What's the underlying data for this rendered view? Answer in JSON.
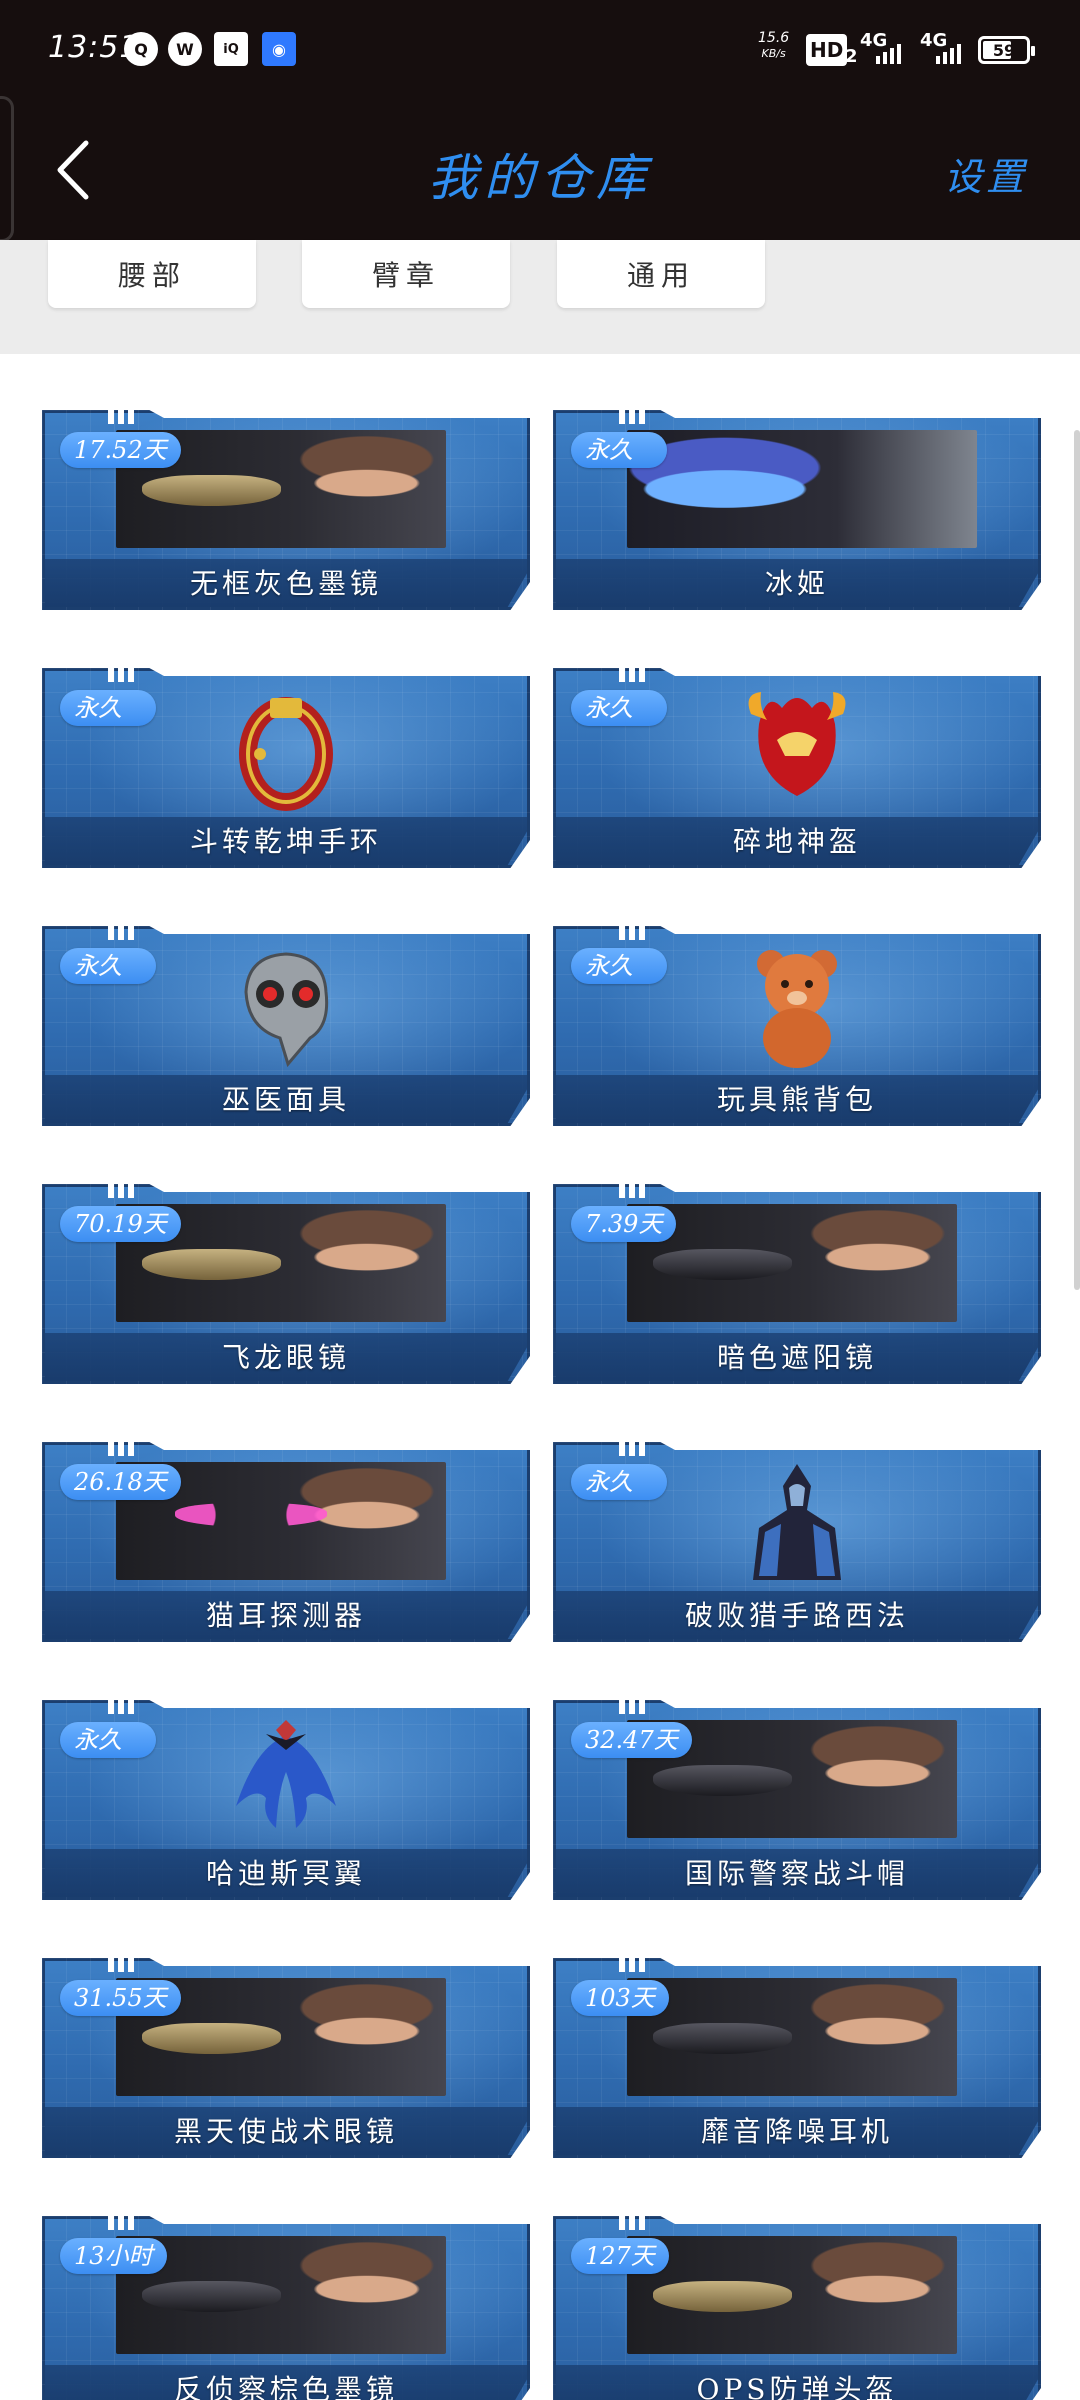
{
  "status_bar": {
    "time": "13:51",
    "apps": [
      "QQ",
      "WeChat",
      "iQIYI",
      "Signal"
    ],
    "speed_value": "15.6",
    "speed_unit": "KB/s",
    "hd": "HD",
    "hd_sub": "2",
    "net1": "4G",
    "net2": "4G",
    "battery": "59"
  },
  "header": {
    "title": "我的仓库",
    "settings_label": "设置",
    "back_icon": "chevron-left-icon"
  },
  "categories": [
    "腰部",
    "臂章",
    "通用"
  ],
  "items": [
    {
      "name": "无框灰色墨镜",
      "badge": "17.52天",
      "style": "glasses"
    },
    {
      "name": "冰姬",
      "badge": "永久",
      "style": "character"
    },
    {
      "name": "斗转乾坤手环",
      "badge": "永久",
      "style": "bracelet"
    },
    {
      "name": "碎地神盔",
      "badge": "永久",
      "style": "helmet"
    },
    {
      "name": "巫医面具",
      "badge": "永久",
      "style": "mask"
    },
    {
      "name": "玩具熊背包",
      "badge": "永久",
      "style": "bear"
    },
    {
      "name": "飞龙眼镜",
      "badge": "70.19天",
      "style": "glasses"
    },
    {
      "name": "暗色遮阳镜",
      "badge": "7.39天",
      "style": "glasses"
    },
    {
      "name": "猫耳探测器",
      "badge": "26.18天",
      "style": "ears"
    },
    {
      "name": "破败猎手路西法",
      "badge": "永久",
      "style": "figure"
    },
    {
      "name": "哈迪斯冥翼",
      "badge": "永久",
      "style": "wings"
    },
    {
      "name": "国际警察战斗帽",
      "badge": "32.47天",
      "style": "glasses"
    },
    {
      "name": "黑天使战术眼镜",
      "badge": "31.55天",
      "style": "glasses"
    },
    {
      "name": "靡音降噪耳机",
      "badge": "103天",
      "style": "glasses"
    },
    {
      "name": "反侦察棕色墨镜",
      "badge": "13小时",
      "style": "glasses"
    },
    {
      "name": "OPS防弹头盔",
      "badge": "127天",
      "style": "glasses"
    }
  ],
  "colors": {
    "header_bg": "#160e0e",
    "accent_blue": "#2f8ef0",
    "card_blue": "#2f6bb0",
    "badge_blue": "#4a9cf7"
  }
}
